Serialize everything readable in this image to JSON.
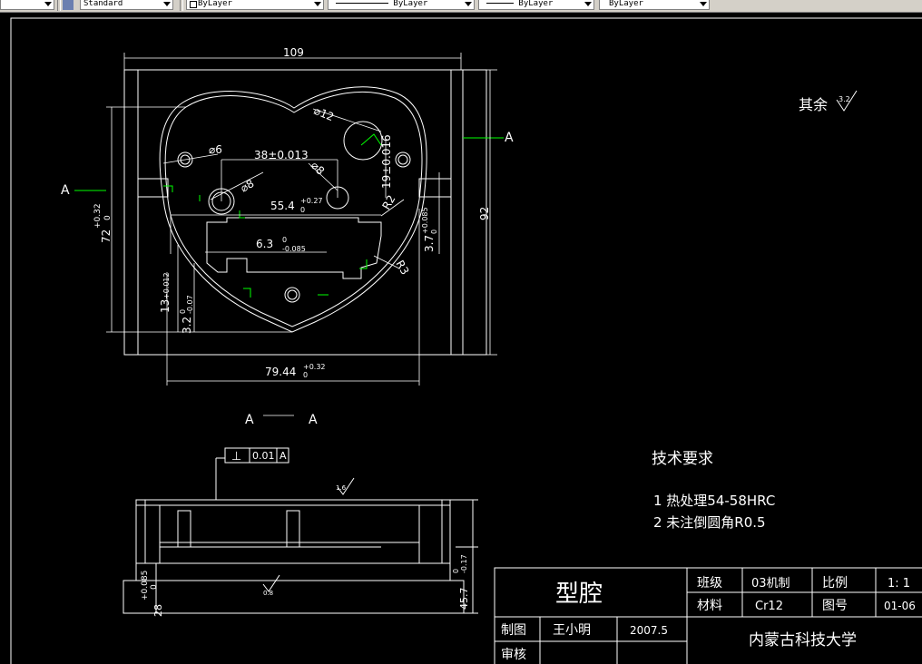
{
  "toolbar": {
    "text_style": "Standard",
    "layer_color": "ByLayer",
    "linetype": "ByLayer",
    "lineweight": "ByLayer",
    "plot_style": "ByLayer"
  },
  "drawing": {
    "top_view": {
      "dim_width": "109",
      "dim_height_right": "92",
      "dim_height_left": "72",
      "dim_height_left_tol_upper": "+0.32",
      "dim_height_left_tol_lower": "0",
      "dim_hole_dia_small": "⌀6",
      "dim_hole_dia_12": "⌀12",
      "dim_hole_dia_8a": "⌀8",
      "dim_hole_dia_8b": "⌀8",
      "dim_38": "38±0.013",
      "dim_55_4": "55.4",
      "dim_55_4_tol_upper": "+0.27",
      "dim_55_4_tol_lower": "0",
      "dim_19": "19±0.016",
      "dim_6_3": "6.3",
      "dim_6_3_tol_upper": "0",
      "dim_6_3_tol_lower": "-0.085",
      "dim_3_7": "3.7",
      "dim_3_7_tol_upper": "+0.085",
      "dim_3_7_tol_lower": "0",
      "dim_13": "13",
      "dim_13_tol": "+0.012",
      "dim_3_2": "3.2",
      "dim_3_2_tol_upper": "0",
      "dim_3_2_tol_lower": "-0.07",
      "dim_r2": "R2",
      "dim_r3": "R3",
      "dim_79_44": "79.44",
      "dim_79_44_tol_upper": "+0.32",
      "dim_79_44_tol_lower": "0",
      "section_mark_left": "A",
      "section_mark_right": "A"
    },
    "section_view": {
      "title_left": "A",
      "title_right": "A",
      "gdt_symbol": "⊥",
      "gdt_tolerance": "0.01",
      "gdt_datum": "A",
      "dim_left_tol_upper": "+0.085",
      "dim_left_tol_lower": "0",
      "dim_left": "28",
      "dim_right": "45.7",
      "dim_right_tol_upper": "0",
      "dim_right_tol_lower": "-0.17",
      "roughness_mark_top": "1.6",
      "roughness_mark_bottom": "0.8"
    },
    "surface_finish_note": "其余",
    "surface_finish_value": "3.2",
    "tech_requirements": {
      "title": "技术要求",
      "items": [
        "1  热处理54-58HRC",
        "2  未注倒圆角R0.5"
      ]
    },
    "title_block": {
      "part_name": "型腔",
      "class_label": "班级",
      "class_value": "03机制",
      "scale_label": "比例",
      "scale_value": "1: 1",
      "material_label": "材料",
      "material_value": "Cr12",
      "drawing_no_label": "图号",
      "drawing_no_value": "01-06",
      "drawn_by_label": "制图",
      "drawn_by_value": "王小明",
      "date_value": "2007.5",
      "checked_by_label": "审核",
      "school": "内蒙古科技大学"
    }
  },
  "colors": {
    "background": "#000000",
    "lines": "#ffffff",
    "centerline": "#00ff00",
    "toolbar": "#d4d0c8"
  }
}
